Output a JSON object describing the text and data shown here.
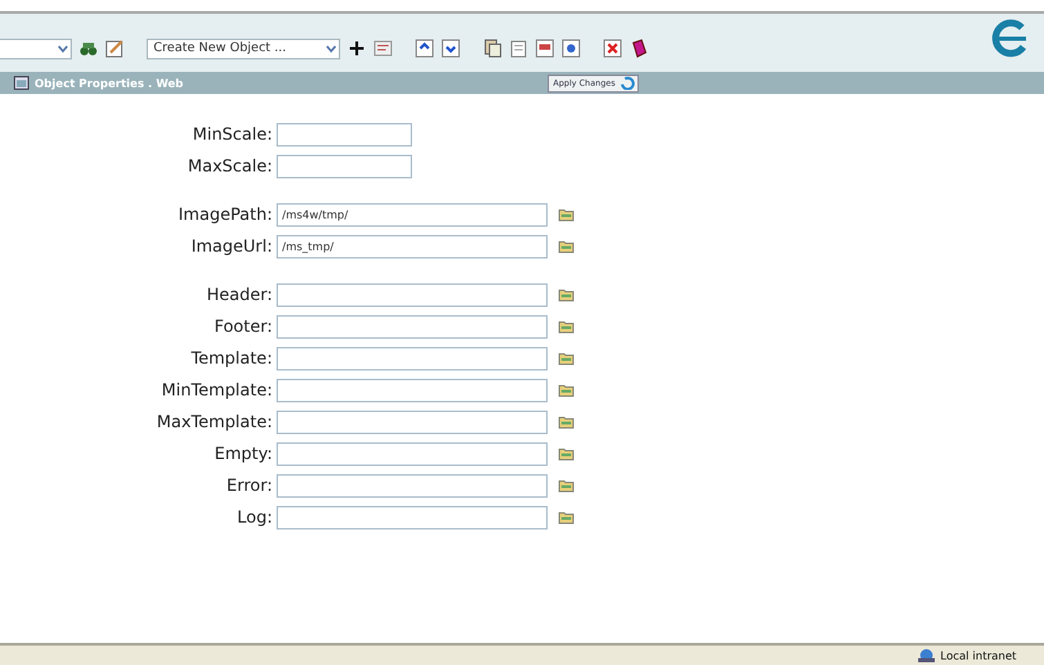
{
  "toolbar": {
    "object_dropdown": {
      "value": "Create New Object ..."
    }
  },
  "panel": {
    "title": "Object Properties . Web",
    "apply_button": "Apply Changes"
  },
  "form_groups": [
    [
      {
        "label": "MinScale:",
        "kind": "short"
      },
      {
        "label": "MaxScale:",
        "kind": "short"
      }
    ],
    [
      {
        "label": "ImagePath:",
        "value": "/ms4w/tmp/",
        "kind": "browse"
      },
      {
        "label": "ImageUrl:",
        "value": "/ms_tmp/",
        "kind": "browse"
      }
    ],
    [
      {
        "label": "Header:",
        "kind": "browse"
      },
      {
        "label": "Footer:",
        "kind": "browse"
      },
      {
        "label": "Template:",
        "kind": "browse"
      },
      {
        "label": "MinTemplate:",
        "kind": "browse"
      },
      {
        "label": "MaxTemplate:",
        "kind": "browse"
      },
      {
        "label": "Empty:",
        "kind": "browse"
      },
      {
        "label": "Error:",
        "kind": "browse"
      },
      {
        "label": "Log:",
        "kind": "browse"
      }
    ]
  ],
  "status_bar": {
    "zone": "Local intranet"
  }
}
